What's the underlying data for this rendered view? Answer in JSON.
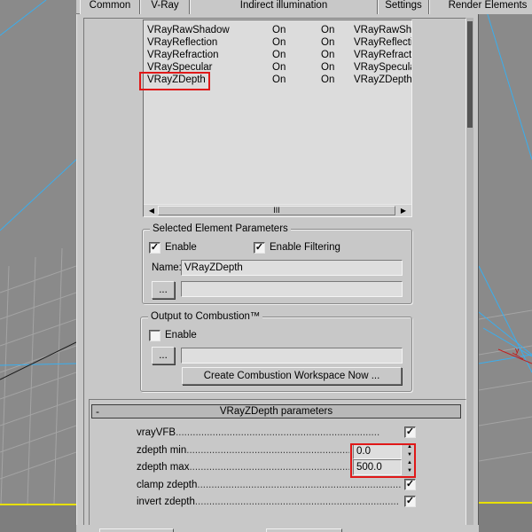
{
  "tabs": [
    "Common",
    "V-Ray",
    "Indirect illumination",
    "Settings",
    "Render Elements"
  ],
  "elements_list": {
    "rows": [
      {
        "name": "VRayRawShadow",
        "enabled": "On",
        "filter": "On",
        "output": "VRayRawSha"
      },
      {
        "name": "VRayReflection",
        "enabled": "On",
        "filter": "On",
        "output": "VRayReflecti"
      },
      {
        "name": "VRayRefraction",
        "enabled": "On",
        "filter": "On",
        "output": "VRayRefracti"
      },
      {
        "name": "VRaySpecular",
        "enabled": "On",
        "filter": "On",
        "output": "VRaySpecula"
      },
      {
        "name": "VRayZDepth",
        "enabled": "On",
        "filter": "On",
        "output": "VRayZDepth"
      }
    ],
    "scroll_thumb_glyph": "III"
  },
  "selected_element": {
    "title": "Selected Element Parameters",
    "enable_label": "Enable",
    "enable_checked": true,
    "enable_filtering_label": "Enable Filtering",
    "enable_filtering_checked": true,
    "name_label": "Name:",
    "name_value": "VRayZDepth",
    "browse_label": "...",
    "path_value": ""
  },
  "combustion": {
    "title": "Output to Combustion™",
    "enable_label": "Enable",
    "enable_checked": false,
    "browse_label": "...",
    "path_value": "",
    "create_button": "Create Combustion Workspace Now ..."
  },
  "rollout": {
    "collapse_symbol": "-",
    "title": "VRayZDepth parameters",
    "params": {
      "vrayvfb": {
        "label": "vrayVFB",
        "checked": true
      },
      "zdepth_min": {
        "label": "zdepth min",
        "value": "0.0"
      },
      "zdepth_max": {
        "label": "zdepth max",
        "value": "500.0"
      },
      "clamp_zdepth": {
        "label": "clamp zdepth",
        "checked": true
      },
      "invert_zdepth": {
        "label": "invert zdepth",
        "checked": true
      }
    }
  },
  "viewport": {
    "axis_label": "y"
  },
  "colors": {
    "highlight": "#e01818",
    "dialog_bg": "#c8c8c8",
    "viewport_bg": "#8c8c8c",
    "wire_blue": "#3aaeee",
    "ground_yellow": "#e8e000"
  }
}
